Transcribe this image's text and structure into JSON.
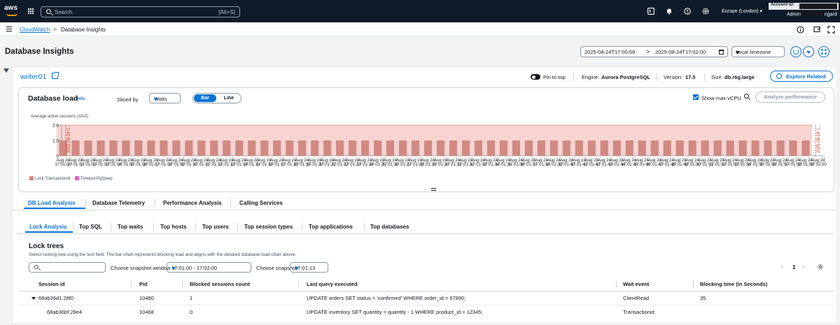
{
  "nav": {
    "logo_text": "aws",
    "search_placeholder": "Search",
    "search_shortcut": "[Alt+S]",
    "region": "Europe (London) ▾",
    "account_id_label": "Account ID:",
    "user_prefix": "Admin",
    "user_suffix": "ngard"
  },
  "breadcrumb": {
    "service": "CloudWatch",
    "separator": ">",
    "current": "Database Insights"
  },
  "header": {
    "title": "Database Insights",
    "start": "2025-08-24T17:00:59",
    "end": "2025-08-24T17:02:00",
    "range_arrow": ">",
    "timezone": "Local timezone"
  },
  "instance": {
    "name": "writer01",
    "pin_label": "Pin to top",
    "engine_label": "Engine:",
    "engine": "Aurora PostgreSQL",
    "version_label": "Version:",
    "version": "17.5",
    "size_label": "Size:",
    "size": "db.r6g.large",
    "explore_label": "Explore Related"
  },
  "load": {
    "title": "Database load",
    "info": "Info",
    "sliced_by_label": "Sliced by",
    "sliced_by_value": "Waits",
    "view_bar": "Bar",
    "view_line": "Line",
    "show_max_label": "Show max vCPU",
    "analyze_label": "Analyze performance",
    "drag_handle": "="
  },
  "chart_data": {
    "type": "bar",
    "ylabel": "Average active sessions (AAS)",
    "ylim": [
      0,
      2.0
    ],
    "yticks": [
      "0",
      "1.0",
      "2.0"
    ],
    "xlabel_top": "Aug 24",
    "x": [
      "17:01:00",
      "17:01:01",
      "17:01:02",
      "17:01:03",
      "17:01:04",
      "17:01:05",
      "17:01:06",
      "17:01:07",
      "17:01:08",
      "17:01:09",
      "17:01:10",
      "17:01:11",
      "17:01:12",
      "17:01:13",
      "17:01:14",
      "17:01:15",
      "17:01:16",
      "17:01:17",
      "17:01:18",
      "17:01:19",
      "17:01:20",
      "17:01:21",
      "17:01:22",
      "17:01:23",
      "17:01:24",
      "17:01:25",
      "17:01:26",
      "17:01:27",
      "17:01:28",
      "17:01:29",
      "17:01:30",
      "17:01:31",
      "17:01:32",
      "17:01:33",
      "17:01:34",
      "17:01:35",
      "17:01:36",
      "17:01:37",
      "17:01:38",
      "17:01:39",
      "17:01:40",
      "17:01:41",
      "17:01:42",
      "17:01:43",
      "17:01:44",
      "17:01:45",
      "17:01:46",
      "17:01:47",
      "17:01:48",
      "17:01:49",
      "17:01:50",
      "17:01:51",
      "17:01:52",
      "17:01:53",
      "17:01:54",
      "17:01:55",
      "17:01:56",
      "17:01:57",
      "17:01:58",
      "17:01:59",
      "17:02:00"
    ],
    "series": [
      {
        "name": "Lock:Transactionid",
        "color": "#d08a83",
        "values": [
          1,
          1,
          1,
          1,
          1,
          1,
          1,
          1,
          1,
          1,
          1,
          1,
          1,
          1,
          1,
          1,
          1,
          1,
          1,
          1,
          1,
          1,
          1,
          1,
          1,
          1,
          1,
          1,
          1,
          1,
          1,
          1,
          1,
          1,
          1,
          1,
          1,
          1,
          1,
          1,
          1,
          1,
          1,
          1,
          1,
          1,
          1,
          1,
          1,
          1,
          1,
          1,
          1,
          1,
          1,
          1,
          1,
          1,
          1,
          1,
          0
        ]
      },
      {
        "name": "Timeout:PgSleep",
        "color": "#e15fbf",
        "values": []
      }
    ],
    "highlight_range": {
      "start": "17:01:00",
      "end": "17:01:59",
      "color": "#f6d4d1"
    },
    "markers": [
      {
        "at": "17:01:00",
        "label": "2025-08-24 1..."
      },
      {
        "at": "17:02:00",
        "label": "2025-08-24 1..."
      }
    ],
    "grid": false,
    "legend_position": "bottom-left"
  },
  "tabs_primary": [
    "DB Load Analysis",
    "Database Telemetry",
    "Performance Analysis",
    "Calling Services"
  ],
  "tabs_secondary": [
    "Lock Analysis",
    "Top SQL",
    "Top waits",
    "Top hosts",
    "Top users",
    "Top session types",
    "Top applications",
    "Top databases"
  ],
  "lock_trees": {
    "title": "Lock trees",
    "description": "Select locking tree using the text field. The bar chart represents blocking load and aligns with the detailed database load chart above.",
    "snapshot_window_label": "Choose snapshot window",
    "snapshot_window_value": "17:01:00 - 17:02:00",
    "snapshot_label": "Choose snapshot",
    "snapshot_value": "17:01:13",
    "page_prev": "‹",
    "page": "1",
    "page_next": "›",
    "columns": [
      "Session id",
      "Pid",
      "Blocked sessions count",
      "Last query executed",
      "Wait event",
      "Blocking time (In Seconds)"
    ],
    "rows": [
      [
        "68ab36d1.28f0",
        "10480",
        "1",
        "UPDATE orders SET status = 'confirmed' WHERE order_id = 67890;",
        "ClientRead",
        "35"
      ],
      [
        "68ab36bf.28e4",
        "10468",
        "0",
        "UPDATE inventory SET quantity = quantity - 1 WHERE product_id = 12345;",
        "Transactionid",
        ""
      ]
    ]
  }
}
